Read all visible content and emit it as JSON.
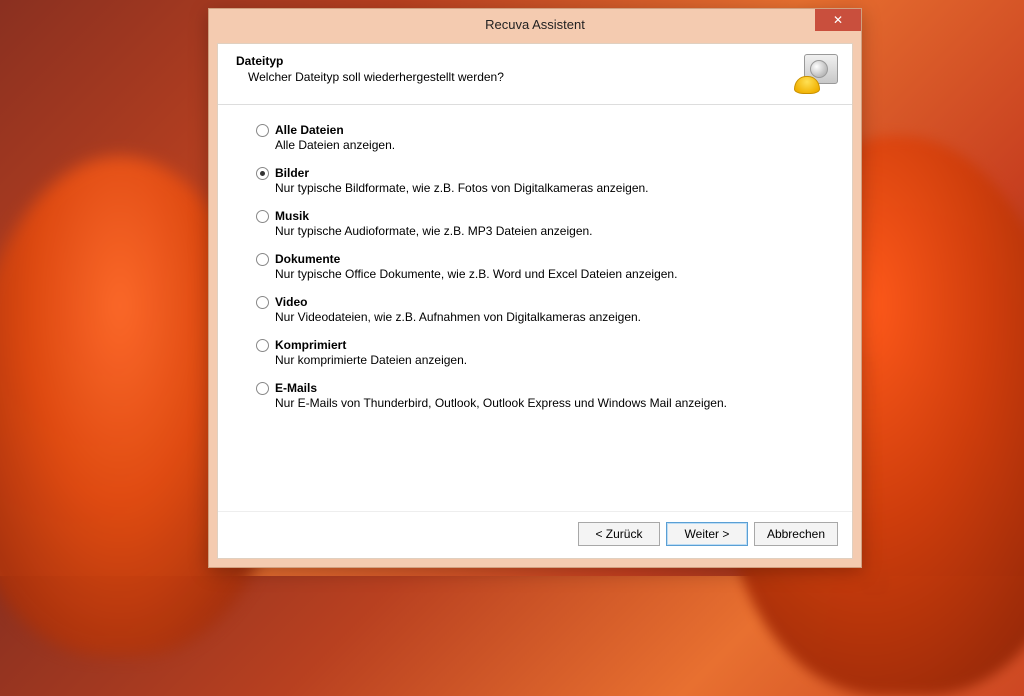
{
  "window": {
    "title": "Recuva Assistent",
    "close_glyph": "✕"
  },
  "header": {
    "title": "Dateityp",
    "subtitle": "Welcher Dateityp soll wiederhergestellt werden?"
  },
  "options": [
    {
      "id": "all",
      "label": "Alle Dateien",
      "desc": "Alle Dateien anzeigen.",
      "selected": false
    },
    {
      "id": "pictures",
      "label": "Bilder",
      "desc": "Nur typische Bildformate, wie z.B. Fotos von Digitalkameras anzeigen.",
      "selected": true
    },
    {
      "id": "music",
      "label": "Musik",
      "desc": "Nur typische Audioformate, wie z.B. MP3 Dateien anzeigen.",
      "selected": false
    },
    {
      "id": "documents",
      "label": "Dokumente",
      "desc": "Nur typische Office Dokumente, wie z.B. Word und Excel Dateien anzeigen.",
      "selected": false
    },
    {
      "id": "video",
      "label": "Video",
      "desc": "Nur Videodateien, wie z.B. Aufnahmen von Digitalkameras anzeigen.",
      "selected": false
    },
    {
      "id": "compressed",
      "label": "Komprimiert",
      "desc": "Nur komprimierte Dateien anzeigen.",
      "selected": false
    },
    {
      "id": "emails",
      "label": "E-Mails",
      "desc": "Nur E-Mails von Thunderbird, Outlook, Outlook Express und Windows Mail anzeigen.",
      "selected": false
    }
  ],
  "footer": {
    "back": "< Zurück",
    "next": "Weiter >",
    "cancel": "Abbrechen"
  }
}
